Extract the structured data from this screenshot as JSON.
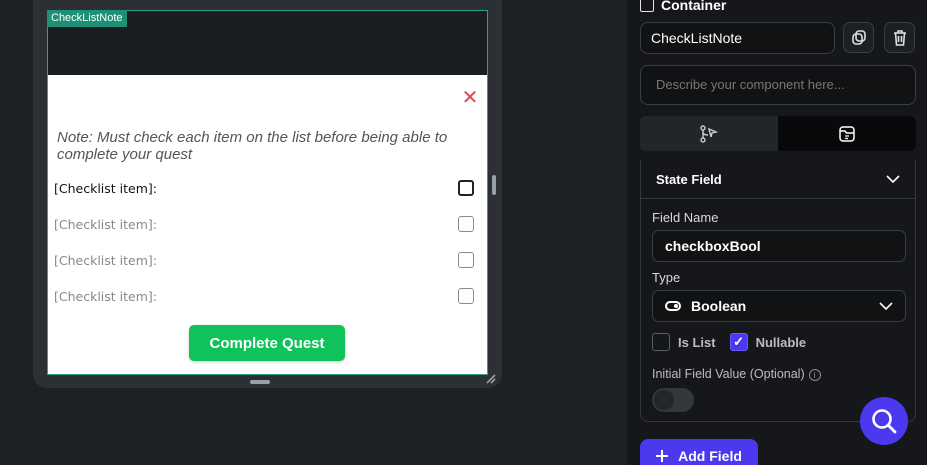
{
  "canvas": {
    "component_tag": "CheckListNote",
    "note_text": "Note: Must check each item on the list before being able to complete your quest",
    "checklist": [
      {
        "label": "[Checklist item]:",
        "faded": false
      },
      {
        "label": "[Checklist item]:",
        "faded": true
      },
      {
        "label": "[Checklist item]:",
        "faded": true
      },
      {
        "label": "[Checklist item]:",
        "faded": true
      }
    ],
    "complete_button": "Complete Quest",
    "close_icon": "close-icon"
  },
  "panel": {
    "container_label": "Container",
    "component_name": "CheckListNote",
    "description_placeholder": "Describe your component here...",
    "state_field": {
      "title": "State Field",
      "field_name_label": "Field Name",
      "field_name_value": "checkboxBool",
      "type_label": "Type",
      "type_value": "Boolean",
      "is_list_label": "Is List",
      "is_list_checked": false,
      "nullable_label": "Nullable",
      "nullable_checked": true,
      "initial_value_label": "Initial Field Value (Optional)"
    },
    "add_field_label": "Add Field"
  },
  "colors": {
    "accent": "#4b39ef",
    "quest_green": "#0fc35a",
    "close_red": "#e04848",
    "tag_teal": "#1f8f78"
  }
}
